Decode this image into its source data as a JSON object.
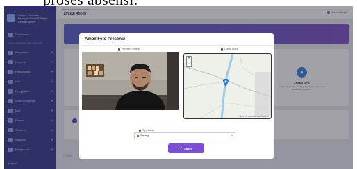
{
  "document_text": "proses absensi.",
  "app": {
    "brand_line1": "Sistem Informasi",
    "brand_line2": "Kepegawaian PT Sejati",
    "brand_line3": "Kemakmuran"
  },
  "sidebar": {
    "section_label": "MANAJEMEN KEPEGAWAIAN",
    "items": [
      {
        "label": "Dashboard",
        "icon": "home-icon"
      },
      {
        "label": "Karyawan",
        "icon": "users-icon"
      },
      {
        "label": "Presensi",
        "icon": "calendar-icon"
      },
      {
        "label": "Rekapitulasi",
        "icon": "chart-icon"
      },
      {
        "label": "Cuti",
        "icon": "file-icon"
      },
      {
        "label": "Penggajian",
        "icon": "wallet-icon"
      },
      {
        "label": "Surat Pengantar",
        "icon": "mail-icon"
      },
      {
        "label": "Mail",
        "icon": "envelope-icon"
      },
      {
        "label": "Proses",
        "icon": "cog-icon"
      },
      {
        "label": "Absensi",
        "icon": "clock-icon"
      },
      {
        "label": "Aktivitas",
        "icon": "list-icon"
      },
      {
        "label": "Pengaturan",
        "icon": "settings-icon"
      }
    ],
    "footer_label": "Logout"
  },
  "topbar": {
    "breadcrumb": "Home / Tambah Absen",
    "title": "Tambah Absen",
    "user_name": "Admin Sejati"
  },
  "background": {
    "gps_title": "Lokasi GPS",
    "gps_desc": "Izinkan akses lokasi GPS di perangkat Anda untuk melakukan presensi",
    "footer": "© 2024"
  },
  "modal": {
    "title": "Ambil Foto Presensi",
    "photo_caption": "Preview Kamera",
    "map_caption": "Lokasi Anda",
    "zoom_in": "+",
    "zoom_out": "−",
    "map_attribution": "Leaflet | © OpenStreetMap contributors",
    "mood_label": "Tipe Mood",
    "mood_value": "Senang",
    "mood_chevron": "▾",
    "submit_label": "Absen",
    "submit_icon": "✓"
  },
  "colors": {
    "sidebar": "#3b3f8f",
    "accent": "#7a4fd0",
    "map_pin": "#2f7fe0"
  }
}
